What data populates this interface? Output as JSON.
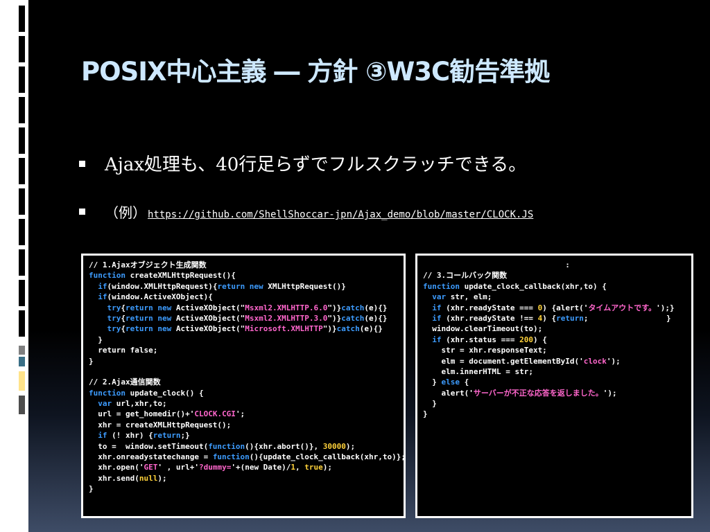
{
  "slide": {
    "title": "POSIX中心主義 ― 方針 ③W3C勧告準拠",
    "bullets": [
      {
        "text": "Ajax処理も、40行足らずでフルスクラッチできる。"
      },
      {
        "prefix": "（例）",
        "link": "https://github.com/ShellShoccar-jpn/Ajax_demo/blob/master/CLOCK.JS"
      }
    ]
  },
  "colors": {
    "title": "#cde8ff",
    "keyword": "#3d9cff",
    "string": "#ff66cc",
    "number": "#ffd23a",
    "bar_gray": "#7f7f7f",
    "bar_teal": "#3a6f86",
    "bar_yellow": "#ffe38a",
    "bar_dark": "#4d4d4d"
  },
  "code_left": [
    [
      [
        "p",
        "// 1.Ajaxオブジェクト生成関数"
      ]
    ],
    [
      [
        "k",
        "function"
      ],
      [
        "p",
        " createXMLHttpRequest(){"
      ]
    ],
    [
      [
        "p",
        "  "
      ],
      [
        "k",
        "if"
      ],
      [
        "p",
        "(window.XMLHttpRequest){"
      ],
      [
        "k",
        "return new"
      ],
      [
        "p",
        " XMLHttpRequest()}"
      ]
    ],
    [
      [
        "p",
        "  "
      ],
      [
        "k",
        "if"
      ],
      [
        "p",
        "(window.ActiveXObject){"
      ]
    ],
    [
      [
        "p",
        "    "
      ],
      [
        "k",
        "try"
      ],
      [
        "p",
        "{"
      ],
      [
        "k",
        "return new"
      ],
      [
        "p",
        " ActiveXObject(\""
      ],
      [
        "s",
        "Msxml2.XMLHTTP.6.0"
      ],
      [
        "p",
        "\")}"
      ],
      [
        "k",
        "catch"
      ],
      [
        "p",
        "(e){}"
      ]
    ],
    [
      [
        "p",
        "    "
      ],
      [
        "k",
        "try"
      ],
      [
        "p",
        "{"
      ],
      [
        "k",
        "return new"
      ],
      [
        "p",
        " ActiveXObject(\""
      ],
      [
        "s",
        "Msxml2.XMLHTTP.3.0"
      ],
      [
        "p",
        "\")}"
      ],
      [
        "k",
        "catch"
      ],
      [
        "p",
        "(e){}"
      ]
    ],
    [
      [
        "p",
        "    "
      ],
      [
        "k",
        "try"
      ],
      [
        "p",
        "{"
      ],
      [
        "k",
        "return new"
      ],
      [
        "p",
        " ActiveXObject(\""
      ],
      [
        "s",
        "Microsoft.XMLHTTP"
      ],
      [
        "p",
        "\")}"
      ],
      [
        "k",
        "catch"
      ],
      [
        "p",
        "(e){}"
      ]
    ],
    [
      [
        "p",
        "  }"
      ]
    ],
    [
      [
        "p",
        "  return false;"
      ]
    ],
    [
      [
        "p",
        "}"
      ]
    ],
    [
      [
        "p",
        ""
      ]
    ],
    [
      [
        "p",
        "// 2.Ajax通信関数"
      ]
    ],
    [
      [
        "k",
        "function"
      ],
      [
        "p",
        " update_clock() {"
      ]
    ],
    [
      [
        "p",
        "  "
      ],
      [
        "k",
        "var"
      ],
      [
        "p",
        " url,xhr,to;"
      ]
    ],
    [
      [
        "p",
        "  url = get_homedir()+'"
      ],
      [
        "s",
        "CLOCK.CGI"
      ],
      [
        "p",
        "';"
      ]
    ],
    [
      [
        "p",
        "  xhr = createXMLHttpRequest();"
      ]
    ],
    [
      [
        "p",
        "  "
      ],
      [
        "k",
        "if"
      ],
      [
        "p",
        " (! xhr) {"
      ],
      [
        "k",
        "return"
      ],
      [
        "p",
        ";}"
      ]
    ],
    [
      [
        "p",
        "  to =  window.setTimeout("
      ],
      [
        "k",
        "function"
      ],
      [
        "p",
        "(){xhr.abort()}, "
      ],
      [
        "n",
        "30000"
      ],
      [
        "p",
        ");"
      ]
    ],
    [
      [
        "p",
        "  xhr.onreadystatechange = "
      ],
      [
        "k",
        "function"
      ],
      [
        "p",
        "(){update_clock_callback(xhr,to)};"
      ]
    ],
    [
      [
        "p",
        "  xhr.open('"
      ],
      [
        "s",
        "GET"
      ],
      [
        "p",
        "' , url+'"
      ],
      [
        "s",
        "?dummy="
      ],
      [
        "p",
        "'+(new Date)/"
      ],
      [
        "n",
        "1"
      ],
      [
        "p",
        ", "
      ],
      [
        "n",
        "true"
      ],
      [
        "p",
        ");"
      ]
    ],
    [
      [
        "p",
        "  xhr.send("
      ],
      [
        "n",
        "null"
      ],
      [
        "p",
        ");"
      ]
    ],
    [
      [
        "p",
        "}"
      ]
    ],
    [
      [
        "p",
        ""
      ]
    ],
    [
      [
        "p",
        ""
      ]
    ],
    [
      [
        "p",
        "                           :"
      ]
    ]
  ],
  "code_right": [
    [
      [
        "p",
        "                               :"
      ]
    ],
    [
      [
        "p",
        "// 3.コールバック関数"
      ]
    ],
    [
      [
        "k",
        "function"
      ],
      [
        "p",
        " update_clock_callback(xhr,to) {"
      ]
    ],
    [
      [
        "p",
        "  "
      ],
      [
        "k",
        "var"
      ],
      [
        "p",
        " str, elm;"
      ]
    ],
    [
      [
        "p",
        "  "
      ],
      [
        "k",
        "if"
      ],
      [
        "p",
        " (xhr.readyState === "
      ],
      [
        "n",
        "0"
      ],
      [
        "p",
        ") {alert('"
      ],
      [
        "s",
        "タイムアウトです。"
      ],
      [
        "p",
        "');}"
      ]
    ],
    [
      [
        "p",
        "  "
      ],
      [
        "k",
        "if"
      ],
      [
        "p",
        " (xhr.readyState !== "
      ],
      [
        "n",
        "4"
      ],
      [
        "p",
        ") {"
      ],
      [
        "k",
        "return"
      ],
      [
        "p",
        ";                 }"
      ]
    ],
    [
      [
        "p",
        "  window.clearTimeout(to);"
      ]
    ],
    [
      [
        "p",
        "  "
      ],
      [
        "k",
        "if"
      ],
      [
        "p",
        " (xhr.status === "
      ],
      [
        "n",
        "200"
      ],
      [
        "p",
        ") {"
      ]
    ],
    [
      [
        "p",
        "    str = xhr.responseText;"
      ]
    ],
    [
      [
        "p",
        "    elm = document.getElementById('"
      ],
      [
        "s",
        "clock"
      ],
      [
        "p",
        "');"
      ]
    ],
    [
      [
        "p",
        "    elm.innerHTML = str;"
      ]
    ],
    [
      [
        "p",
        "  } "
      ],
      [
        "k",
        "else"
      ],
      [
        "p",
        " {"
      ]
    ],
    [
      [
        "p",
        "    alert('"
      ],
      [
        "s",
        "サーバーが不正な応答を返しました。"
      ],
      [
        "p",
        "');"
      ]
    ],
    [
      [
        "p",
        "  }"
      ]
    ],
    [
      [
        "p",
        "}"
      ]
    ]
  ]
}
